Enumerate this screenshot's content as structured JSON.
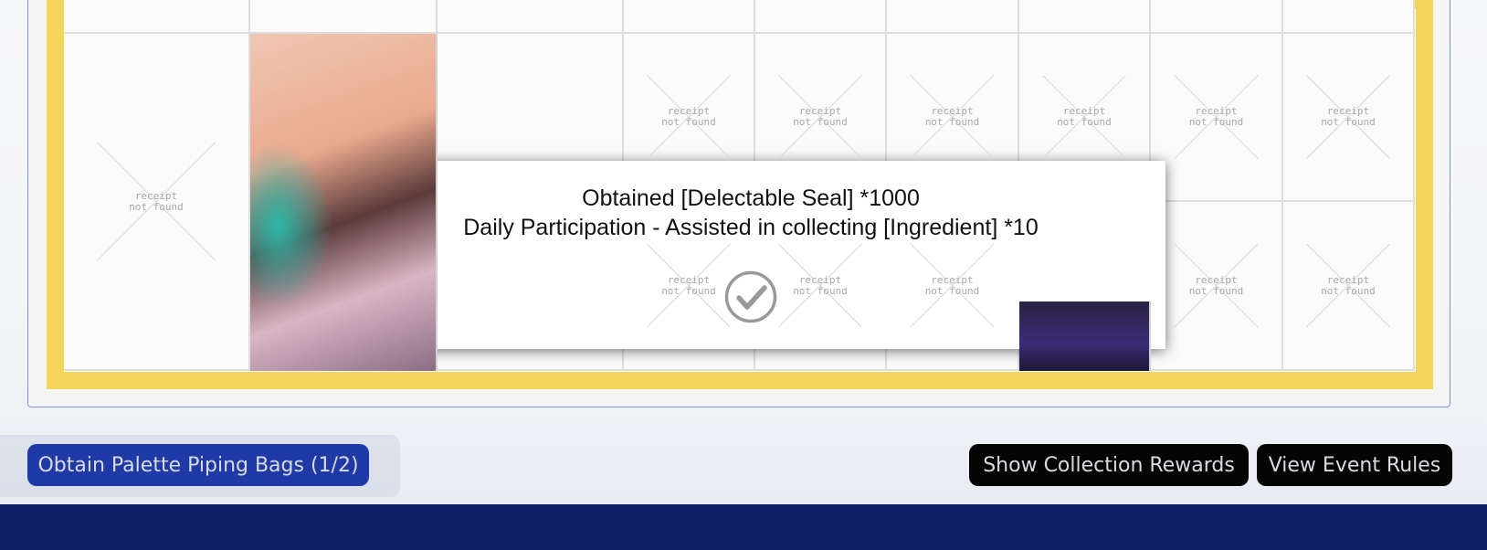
{
  "board": {
    "cells": [
      {
        "id": "r0c0",
        "text": ""
      },
      {
        "id": "r0c1",
        "text": ""
      },
      {
        "id": "r0c2",
        "text": ""
      },
      {
        "id": "r0c3",
        "text": ""
      },
      {
        "id": "r0c4",
        "text": ""
      },
      {
        "id": "r0c5",
        "text": ""
      },
      {
        "id": "r0c6",
        "text": ""
      },
      {
        "id": "r0c7",
        "text": ""
      },
      {
        "id": "r0c8",
        "text": ""
      },
      {
        "id": "r0c9",
        "text": ""
      }
    ],
    "not_found_label_line1": "receipt",
    "not_found_label_line2": "not found"
  },
  "modal": {
    "line1": "Obtained [Delectable Seal] *1000",
    "line2": "Daily Participation - Assisted in collecting [Ingredient] *10",
    "confirm_icon": "check-circle-icon"
  },
  "actions": {
    "obtain_label": "Obtain Palette Piping Bags (1/2)",
    "rewards_label": "Show Collection Rewards",
    "rules_label": "View Event Rules"
  },
  "colors": {
    "gold": "#f0c419",
    "primary_blue": "#1f3aa6",
    "navy_strip": "#0e1f66",
    "black_button": "#050505"
  }
}
